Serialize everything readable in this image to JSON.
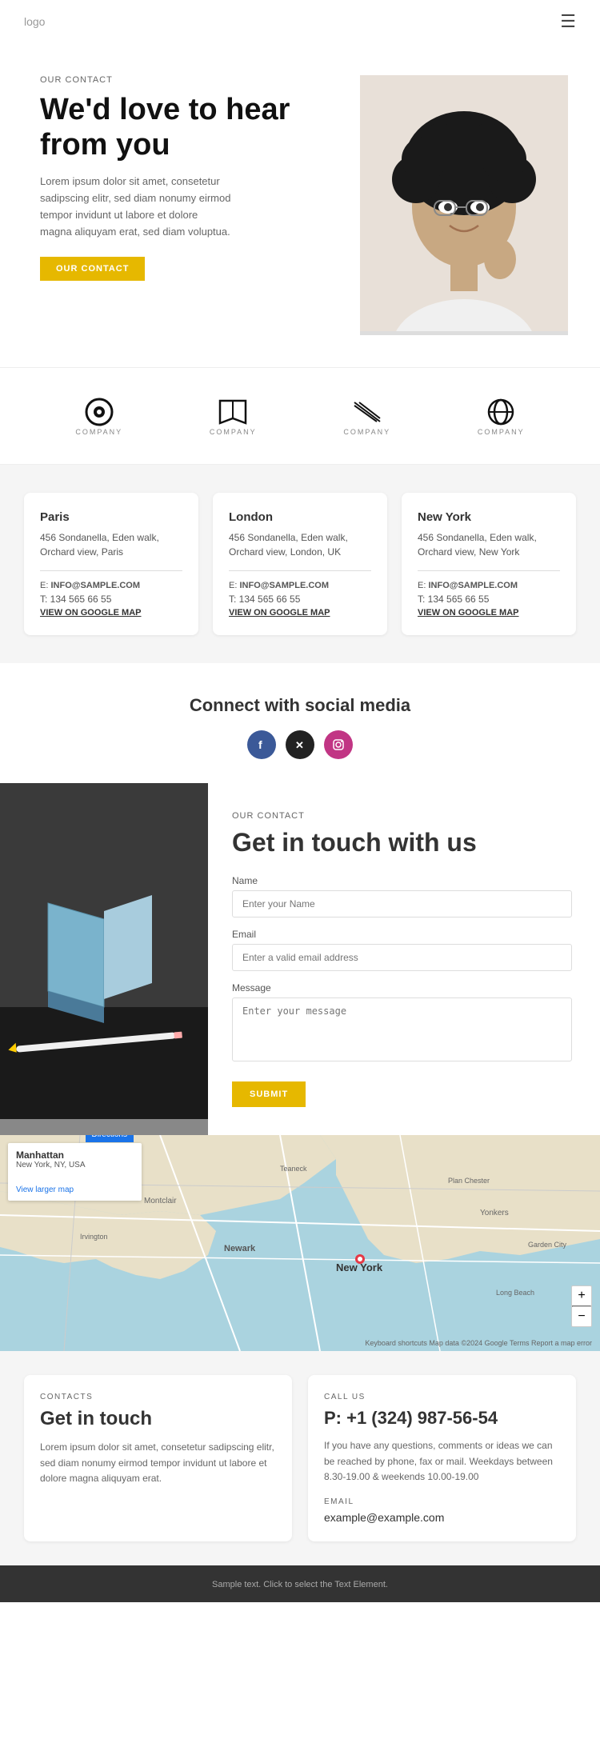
{
  "navbar": {
    "logo": "logo",
    "menu_icon": "☰"
  },
  "hero": {
    "label": "OUR CONTACT",
    "title": "We'd love to hear from you",
    "description": "Lorem ipsum dolor sit amet, consetetur sadipscing elitr, sed diam nonumy eirmod tempor invidunt ut labore et dolore magna aliquyam erat, sed diam voluptua.",
    "button_label": "OUR CONTACT"
  },
  "logos": [
    {
      "symbol": "◉",
      "label": "COMPANY"
    },
    {
      "symbol": "📖",
      "label": "COMPANY"
    },
    {
      "symbol": "⋘",
      "label": "COMPANY"
    },
    {
      "symbol": "⊗",
      "label": "COMPANY"
    }
  ],
  "offices": [
    {
      "city": "Paris",
      "address": "456 Sondanella, Eden walk, Orchard view, Paris",
      "email_label": "E:",
      "email": "INFO@SAMPLE.COM",
      "phone": "T: 134 565 66 55",
      "map_link": "VIEW ON GOOGLE MAP"
    },
    {
      "city": "London",
      "address": "456 Sondanella, Eden walk, Orchard view, London, UK",
      "email_label": "E:",
      "email": "INFO@SAMPLE.COM",
      "phone": "T: 134 565 66 55",
      "map_link": "VIEW ON GOOGLE MAP"
    },
    {
      "city": "New York",
      "address": "456 Sondanella, Eden walk, Orchard view, New York",
      "email_label": "E:",
      "email": "INFO@SAMPLE.COM",
      "phone": "T: 134 565 66 55",
      "map_link": "VIEW ON GOOGLE MAP"
    }
  ],
  "social": {
    "title": "Connect with social media",
    "icons": [
      "f",
      "✕",
      "📷"
    ]
  },
  "contact_form": {
    "label": "OUR CONTACT",
    "title": "Get in touch with us",
    "name_label": "Name",
    "name_placeholder": "Enter your Name",
    "email_label": "Email",
    "email_placeholder": "Enter a valid email address",
    "message_label": "Message",
    "message_placeholder": "Enter your message",
    "submit_label": "SUBMIT"
  },
  "map": {
    "location_name": "Manhattan",
    "location_sub": "New York, NY, USA",
    "directions_label": "Directions",
    "view_larger": "View larger map",
    "credits": "Keyboard shortcuts  Map data ©2024 Google  Terms  Report a map error"
  },
  "bottom_contacts": {
    "left": {
      "label": "CONTACTS",
      "title": "Get in touch",
      "description": "Lorem ipsum dolor sit amet, consetetur sadipscing elitr, sed diam nonumy eirmod tempor invidunt ut labore et dolore magna aliquyam erat."
    },
    "right": {
      "label": "CALL US",
      "phone": "P: +1 (324) 987-56-54",
      "call_description": "If you have any questions, comments or ideas we can be reached by phone, fax or mail. Weekdays between 8.30-19.00 & weekends 10.00-19.00",
      "email_label": "EMAIL",
      "email": "example@example.com"
    }
  },
  "footer": {
    "text": "Sample text. Click to select the Text Element."
  }
}
